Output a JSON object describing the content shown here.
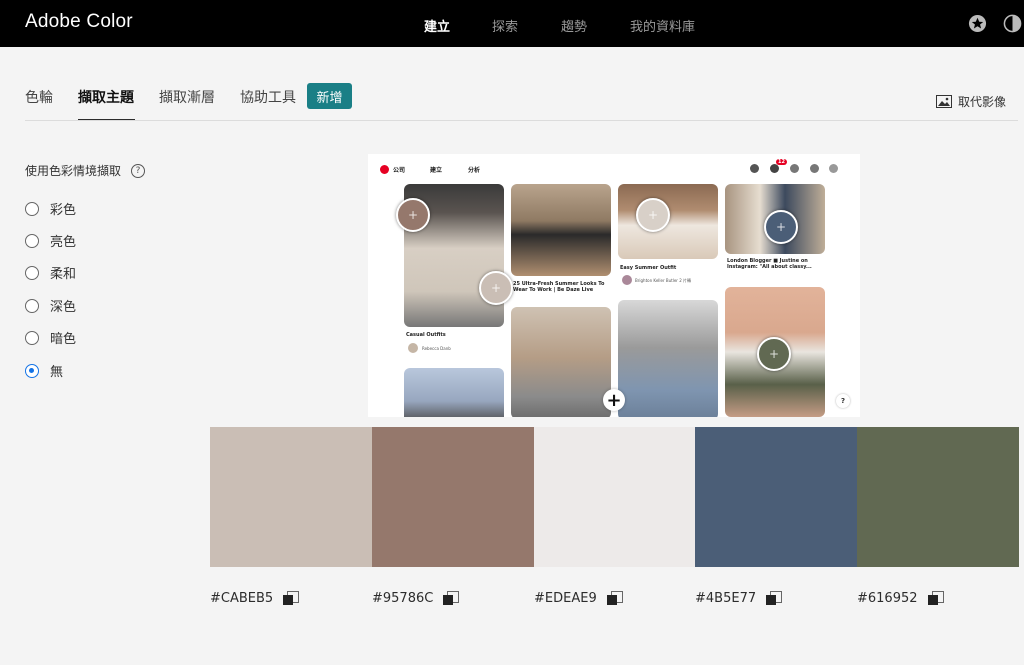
{
  "app": {
    "title": "Adobe Color"
  },
  "top_nav": [
    {
      "label": "建立",
      "active": true
    },
    {
      "label": "探索",
      "active": false
    },
    {
      "label": "趨勢",
      "active": false
    },
    {
      "label": "我的資料庫",
      "active": false
    }
  ],
  "top_icons": [
    "star-icon",
    "theme-toggle-icon"
  ],
  "sub_tabs": [
    {
      "label": "色輪",
      "active": false
    },
    {
      "label": "擷取主題",
      "active": true
    },
    {
      "label": "擷取漸層",
      "active": false
    },
    {
      "label": "協助工具",
      "active": false
    }
  ],
  "new_badge": "新增",
  "replace_image": {
    "label": "取代影像",
    "icon": "image-icon"
  },
  "mood": {
    "heading": "使用色彩情境擷取",
    "help": "?",
    "options": [
      {
        "label": "彩色",
        "checked": false
      },
      {
        "label": "亮色",
        "checked": false
      },
      {
        "label": "柔和",
        "checked": false
      },
      {
        "label": "深色",
        "checked": false
      },
      {
        "label": "暗色",
        "checked": false
      },
      {
        "label": "無",
        "checked": true
      }
    ]
  },
  "preview": {
    "bar": {
      "left1": "公司",
      "left2": "建立",
      "left3": "分析",
      "badge": "12"
    },
    "captions": {
      "c1": "Casual Outfits",
      "c1_user": "Rebecca Danb",
      "c2": "25 Ultra-Fresh Summer Looks To Wear To Work | Be Daze Live",
      "c3": "Easy Summer Outfit",
      "c3_user": "Brighton Keller Butler 2 片轉",
      "c4": "London Blogger ■ Justine on Instagram: \"All about classy...",
      "plus": "+",
      "help": "?"
    }
  },
  "palette": {
    "colors": [
      "#CABEB5",
      "#95786C",
      "#EDEAE9",
      "#4B5E77",
      "#616952"
    ],
    "labels": [
      "#CABEB5",
      "#95786C",
      "#EDEAE9",
      "#4B5E77",
      "#616952"
    ]
  }
}
